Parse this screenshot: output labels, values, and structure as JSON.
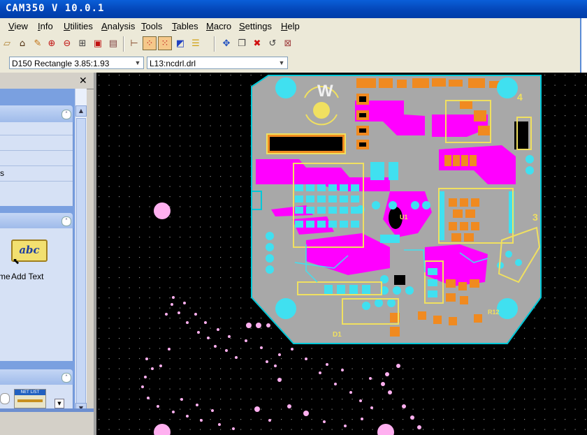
{
  "app": {
    "title": "CAM350 V 10.0.1"
  },
  "menu": {
    "items": [
      {
        "label": "View",
        "u": "V"
      },
      {
        "label": "Info",
        "u": "I"
      },
      {
        "label": "Utilities",
        "u": "U"
      },
      {
        "label": "Analysis",
        "u": "A"
      },
      {
        "label": "Tools",
        "u": "T"
      },
      {
        "label": "Tables",
        "u": "T"
      },
      {
        "label": "Macro",
        "u": "M"
      },
      {
        "label": "Settings",
        "u": "S"
      },
      {
        "label": "Help",
        "u": "H"
      }
    ]
  },
  "options_bar": {
    "dcode_value": "D150  Rectangle 3.85:1.93",
    "layer_value": "L13:ncdrl.drl"
  },
  "left_panel": {
    "close_glyph": "✕",
    "partial_label": "s",
    "tool_partial_label": "me",
    "add_text_label": "Add Text",
    "net_list_label": "NET LIST",
    "add_text_icon_text": "abc"
  },
  "board": {
    "silkscreen_text": [
      "W",
      "4",
      "3",
      "D1",
      "U1",
      "R12"
    ]
  },
  "colors": {
    "canvas": "#000000",
    "board": "#a8a8a8",
    "outline": "#00c8d8",
    "copper_pink": "#ff00ff",
    "pad_cyan": "#40e0f0",
    "smd_orange": "#f08a20",
    "silk_yellow": "#f0e060",
    "via_pink": "#ffb0f0"
  },
  "icons": [
    "new-icon",
    "open-icon",
    "redraw-icon",
    "zoom-in-icon",
    "zoom-out-icon",
    "zoom-window-icon",
    "zoom-all-icon",
    "zoom-prev-icon",
    "snap-icon",
    "grid-icon",
    "grid2-icon",
    "color-icon",
    "layers-icon",
    "move-icon",
    "copy-icon",
    "delete-icon",
    "undo-icon",
    "eraser-icon"
  ]
}
